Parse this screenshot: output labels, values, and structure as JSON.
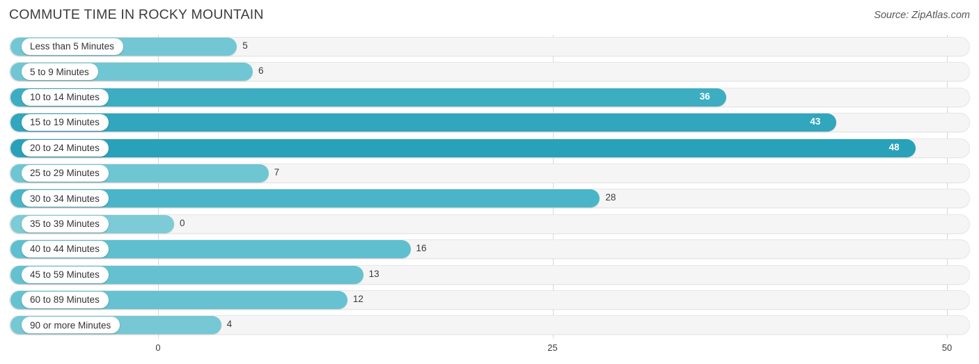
{
  "header": {
    "title": "COMMUTE TIME IN ROCKY MOUNTAIN",
    "source": "Source: ZipAtlas.com"
  },
  "colors": {
    "bar_low": "#7CCBD6",
    "bar_mid": "#4FB8CA",
    "bar_high": "#269FB8",
    "track": "#F5F5F5",
    "track_border": "#E6E6E6",
    "gridline": "#D8D8D8",
    "title_text": "#3C3C3C",
    "label_text": "#333333",
    "value_text": "#3A3A3A",
    "value_text_inside": "#FFFFFF"
  },
  "chart_data": {
    "type": "bar",
    "orientation": "horizontal",
    "title": "COMMUTE TIME IN ROCKY MOUNTAIN",
    "xlabel": "",
    "ylabel": "",
    "xlim": [
      0,
      50
    ],
    "xticks": [
      0,
      25,
      50
    ],
    "xtick_labels": [
      "0",
      "25",
      "50"
    ],
    "grid": true,
    "legend": false,
    "categories": [
      "Less than 5 Minutes",
      "5 to 9 Minutes",
      "10 to 14 Minutes",
      "15 to 19 Minutes",
      "20 to 24 Minutes",
      "25 to 29 Minutes",
      "30 to 34 Minutes",
      "35 to 39 Minutes",
      "40 to 44 Minutes",
      "45 to 59 Minutes",
      "60 to 89 Minutes",
      "90 or more Minutes"
    ],
    "values": [
      5,
      6,
      36,
      43,
      48,
      7,
      28,
      0,
      16,
      13,
      12,
      4
    ],
    "value_labels": [
      "5",
      "6",
      "36",
      "43",
      "48",
      "7",
      "28",
      "0",
      "16",
      "13",
      "12",
      "4"
    ]
  }
}
